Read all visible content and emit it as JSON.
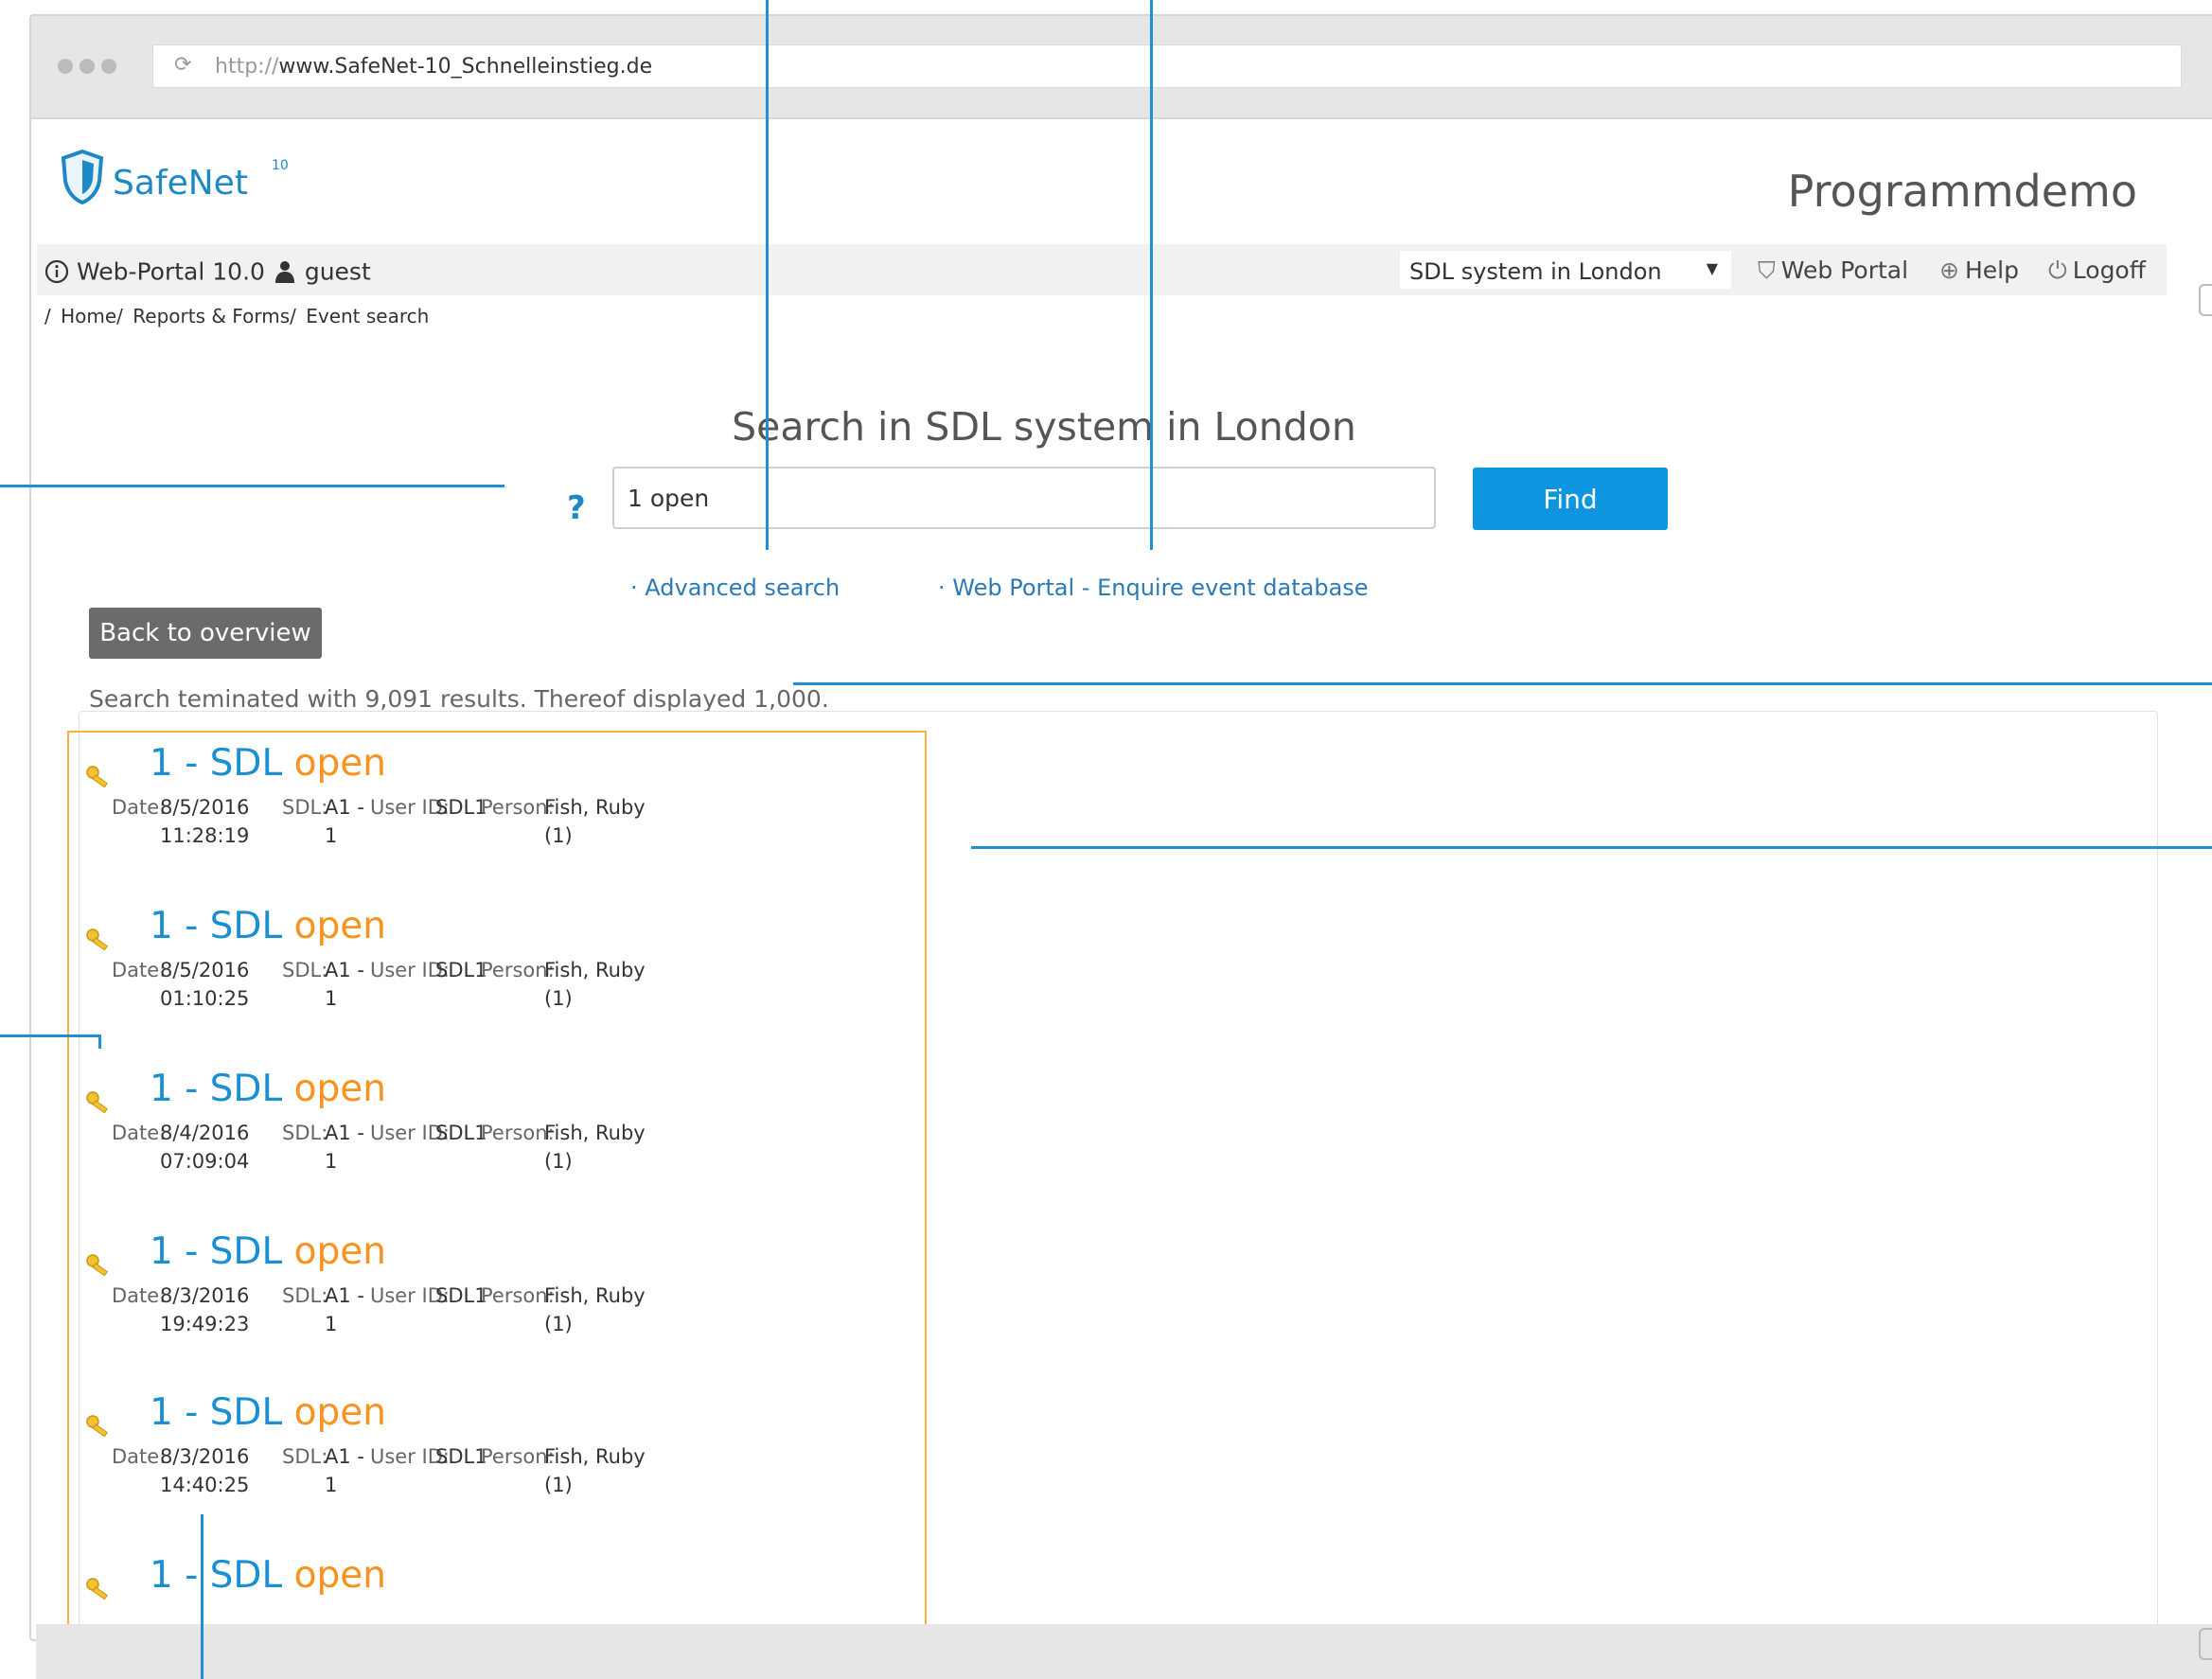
{
  "browser": {
    "url_protocol": "http://",
    "url_host": "www.SafeNet-10_Schnelleinstieg.de"
  },
  "header": {
    "logo_text": "SafeNet",
    "logo_superscript": "10",
    "title": "Programmdemo"
  },
  "navbar": {
    "portal_version": "Web-Portal 10.0",
    "user": "guest",
    "system_select": "SDL system in London",
    "web_portal": "Web Portal",
    "help": "Help",
    "logoff": "Logoff"
  },
  "breadcrumb": [
    "Home/",
    "Reports & Forms/",
    "Event search"
  ],
  "search": {
    "title": "Search in SDL system in London",
    "help_symbol": "?",
    "query": "1 open",
    "find_label": "Find",
    "advanced_link": "· Advanced search",
    "enquire_link": "· Web Portal - Enquire event database"
  },
  "results": {
    "back_label": "Back to overview",
    "summary": "Search teminated with 9,091 results. Thereof displayed 1,000.",
    "labels": {
      "date": "Date:",
      "sdl": "SDL:",
      "user_id": "User ID:",
      "person": "Person:"
    },
    "entries": [
      {
        "title_prefix": "1 - SDL",
        "title_status": "open",
        "date": "8/5/2016",
        "time": "11:28:19",
        "sdl_a": "A1 -",
        "sdl_b": "1",
        "user_id": "SDL1",
        "person_a": "Fish, Ruby",
        "person_b": "(1)"
      },
      {
        "title_prefix": "1 - SDL",
        "title_status": "open",
        "date": "8/5/2016",
        "time": "01:10:25",
        "sdl_a": "A1 -",
        "sdl_b": "1",
        "user_id": "SDL1",
        "person_a": "Fish, Ruby",
        "person_b": "(1)"
      },
      {
        "title_prefix": "1 - SDL",
        "title_status": "open",
        "date": "8/4/2016",
        "time": "07:09:04",
        "sdl_a": "A1 -",
        "sdl_b": "1",
        "user_id": "SDL1",
        "person_a": "Fish, Ruby",
        "person_b": "(1)"
      },
      {
        "title_prefix": "1 - SDL",
        "title_status": "open",
        "date": "8/3/2016",
        "time": "19:49:23",
        "sdl_a": "A1 -",
        "sdl_b": "1",
        "user_id": "SDL1",
        "person_a": "Fish, Ruby",
        "person_b": "(1)"
      },
      {
        "title_prefix": "1 - SDL",
        "title_status": "open",
        "date": "8/3/2016",
        "time": "14:40:25",
        "sdl_a": "A1 -",
        "sdl_b": "1",
        "user_id": "SDL1",
        "person_a": "Fish, Ruby",
        "person_b": "(1)"
      },
      {
        "title_prefix": "1 - SDL",
        "title_status": "open"
      }
    ]
  },
  "colors": {
    "accent_blue": "#1a8fd1",
    "status_orange": "#f7931e",
    "highlight_border": "#f4b43d",
    "find_button": "#0d95df",
    "callout_line": "#1f8fd6"
  },
  "icons": [
    "reload-icon",
    "shield-logo-icon",
    "info-icon",
    "user-icon",
    "caret-down-icon",
    "shield-icon",
    "lifebuoy-icon",
    "power-icon",
    "key-icon"
  ]
}
